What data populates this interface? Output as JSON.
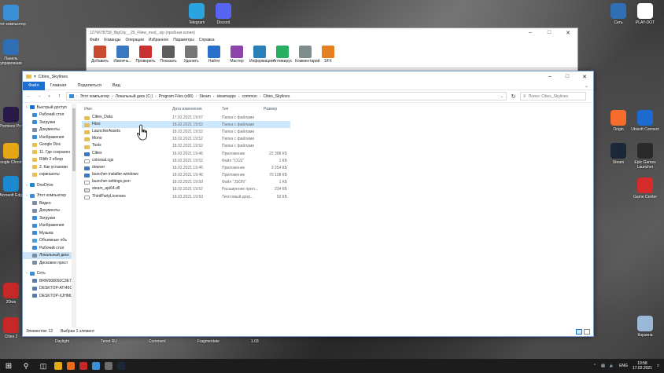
{
  "desktop": {
    "left_icons": [
      {
        "label": "Этот компьютер",
        "color": "#3b8fd6"
      },
      {
        "label": "Панель управления",
        "color": "#2f6fb3"
      },
      {
        "label": "Premiere Pro",
        "color": "#2a1a4a"
      },
      {
        "label": "Google Chrome",
        "color": "#e4a817"
      },
      {
        "label": "Microsoft Edge",
        "color": "#1b8ad0"
      },
      {
        "label": "2Dws",
        "color": "#c62828"
      },
      {
        "label": "Cities 2",
        "color": "#c62828"
      }
    ],
    "top_icons": [
      {
        "label": "Telegram",
        "color": "#2aa3de"
      },
      {
        "label": "Discord",
        "color": "#5865f2"
      }
    ],
    "right_icons": [
      {
        "label": "Сеть",
        "color": "#2f6fb3"
      },
      {
        "label": "PLAY-DOT",
        "color": "#ffffff"
      },
      {
        "label": "Origin",
        "color": "#f56c2d"
      },
      {
        "label": "Ubisoft Connect",
        "color": "#1d6bd0"
      },
      {
        "label": "Steam",
        "color": "#1b2838"
      },
      {
        "label": "Epic Games Launcher",
        "color": "#2a2a2a"
      },
      {
        "label": "Game Center",
        "color": "#d62b2b"
      },
      {
        "label": "Корзина",
        "color": "#9ab8d8"
      }
    ],
    "behind_labels": [
      "Daylight",
      "Tenet RU",
      "Comment",
      "Fragmentate",
      "1.03"
    ]
  },
  "archiver": {
    "title": "1276678758_BigCity__25_Filew_mod_.zip (пробная копия)",
    "menu": [
      "Файл",
      "Команды",
      "Операции",
      "Избранное",
      "Параметры",
      "Справка"
    ],
    "tools": [
      {
        "label": "Добавить",
        "color": "#c84a2f"
      },
      {
        "label": "Извлечь...",
        "color": "#3a78c2"
      },
      {
        "label": "Проверить",
        "color": "#c93131"
      },
      {
        "label": "Показать",
        "color": "#5d5d5d"
      },
      {
        "label": "Удалить",
        "color": "#777777"
      },
      {
        "label": "Найти",
        "color": "#2a6fc9"
      },
      {
        "label": "Мастер",
        "color": "#8e44ad"
      },
      {
        "label": "Информация",
        "color": "#2980b9"
      },
      {
        "label": "Антивирус",
        "color": "#27ae60"
      },
      {
        "label": "Комментарий",
        "color": "#7f8c8d"
      },
      {
        "label": "SFX",
        "color": "#e67e22"
      }
    ]
  },
  "explorer": {
    "title": "Cities_Skylines",
    "ribbon_tabs": [
      "Файл",
      "Главная",
      "Поделиться",
      "Вид"
    ],
    "address_parts": [
      "Этот компьютер",
      "Локальный диск (C:)",
      "Program Files (x86)",
      "Steam",
      "steamapps",
      "common",
      "Cities_Skylines"
    ],
    "search_placeholder": "Поиск: Cities_Skylines",
    "sidebar": [
      {
        "label": "Быстрый доступ",
        "level": 1,
        "color": "#1a6fd0"
      },
      {
        "label": "Рабочий стол",
        "level": 2,
        "color": "#3a8ad8"
      },
      {
        "label": "Загрузки",
        "level": 2,
        "color": "#3a8ad8"
      },
      {
        "label": "Документы",
        "level": 2,
        "color": "#7a8ca3"
      },
      {
        "label": "Изображения",
        "level": 2,
        "color": "#3a8ad8"
      },
      {
        "label": "Google Disc",
        "level": 2,
        "color": "#e8bf4c"
      },
      {
        "label": "11. Где сохранен",
        "level": 2,
        "color": "#e8bf4c"
      },
      {
        "label": "Rilith 2 обзор",
        "level": 2,
        "color": "#e8bf4c"
      },
      {
        "label": "2. Как установи",
        "level": 2,
        "color": "#e8bf4c"
      },
      {
        "label": "скриншоты",
        "level": 2,
        "color": "#e8bf4c"
      },
      {
        "label": "OneDrive",
        "level": 1,
        "color": "#1a8ad8"
      },
      {
        "label": "Этот компьютер",
        "level": 1,
        "color": "#3a8ad8"
      },
      {
        "label": "Видео",
        "level": 2,
        "color": "#7a8ca3"
      },
      {
        "label": "Документы",
        "level": 2,
        "color": "#7a8ca3"
      },
      {
        "label": "Загрузки",
        "level": 2,
        "color": "#3a8ad8"
      },
      {
        "label": "Изображения",
        "level": 2,
        "color": "#3a8ad8"
      },
      {
        "label": "Музыка",
        "level": 2,
        "color": "#3a8ad8"
      },
      {
        "label": "Объемные объ",
        "level": 2,
        "color": "#4aa3df"
      },
      {
        "label": "Рабочий стол",
        "level": 2,
        "color": "#3a8ad8"
      },
      {
        "label": "Локальный диск",
        "level": 2,
        "color": "#7a8ca3",
        "selected": true
      },
      {
        "label": "Дисковое прост",
        "level": 2,
        "color": "#7a8ca3"
      },
      {
        "label": "Сеть",
        "level": 1,
        "color": "#3a8ad8"
      },
      {
        "label": "BRW008092C3E7",
        "level": 2,
        "color": "#5a7aa8"
      },
      {
        "label": "DESKTOP-ATI45C",
        "level": 2,
        "color": "#5a7aa8"
      },
      {
        "label": "DESKTOP-XJHML",
        "level": 2,
        "color": "#5a7aa8"
      }
    ],
    "columns": {
      "name": "Имя",
      "date": "Дата изменения",
      "type": "Тип",
      "size": "Размер"
    },
    "files": [
      {
        "name": "Cities_Data",
        "date": "17.02.2021 19:57",
        "type": "Папка с файлами",
        "size": "",
        "kind": "folder"
      },
      {
        "name": "Files",
        "date": "18.02.2021 19:52",
        "type": "Папка с файлами",
        "size": "",
        "kind": "folder",
        "selected": true
      },
      {
        "name": "LauncherAssets",
        "date": "18.02.2021 19:52",
        "type": "Папка с файлами",
        "size": "",
        "kind": "folder"
      },
      {
        "name": "Mono",
        "date": "18.02.2021 19:52",
        "type": "Папка с файлами",
        "size": "",
        "kind": "folder"
      },
      {
        "name": "Tools",
        "date": "18.02.2021 19:52",
        "type": "Папка с файлами",
        "size": "",
        "kind": "folder"
      },
      {
        "name": "Cities",
        "date": "18.02.2021 19:46",
        "type": "Приложение",
        "size": "22 388 КБ",
        "kind": "app"
      },
      {
        "name": "colossal.cgs",
        "date": "18.02.2021 19:52",
        "type": "Файл \"CGS\"",
        "size": "1 КБ",
        "kind": "file"
      },
      {
        "name": "dowser",
        "date": "18.02.2021 19:46",
        "type": "Приложение",
        "size": "3 254 КБ",
        "kind": "app"
      },
      {
        "name": "launcher-installer-windows",
        "date": "18.02.2021 19:46",
        "type": "Приложение",
        "size": "70 108 КБ",
        "kind": "app"
      },
      {
        "name": "launcher-settings.json",
        "date": "18.02.2021 19:50",
        "type": "Файл \"JSON\"",
        "size": "1 КБ",
        "kind": "file"
      },
      {
        "name": "steam_api64.dll",
        "date": "18.02.2021 19:52",
        "type": "Расширение прил...",
        "size": "234 КБ",
        "kind": "cfg"
      },
      {
        "name": "ThirdPartyLicenses",
        "date": "18.02.2021 19:50",
        "type": "Текстовый доку...",
        "size": "50 КБ",
        "kind": "file"
      }
    ],
    "status": {
      "count": "Элементов: 12",
      "selected": "Выбран 1 элемент"
    }
  },
  "taskbar": {
    "lang": "ENG",
    "time": "19:58",
    "date": "17.02.2021",
    "apps": [
      "#e4a817",
      "#e86c1a",
      "#c62828",
      "#3b8fd6",
      "#6d6d6d",
      "#1b2838"
    ]
  }
}
